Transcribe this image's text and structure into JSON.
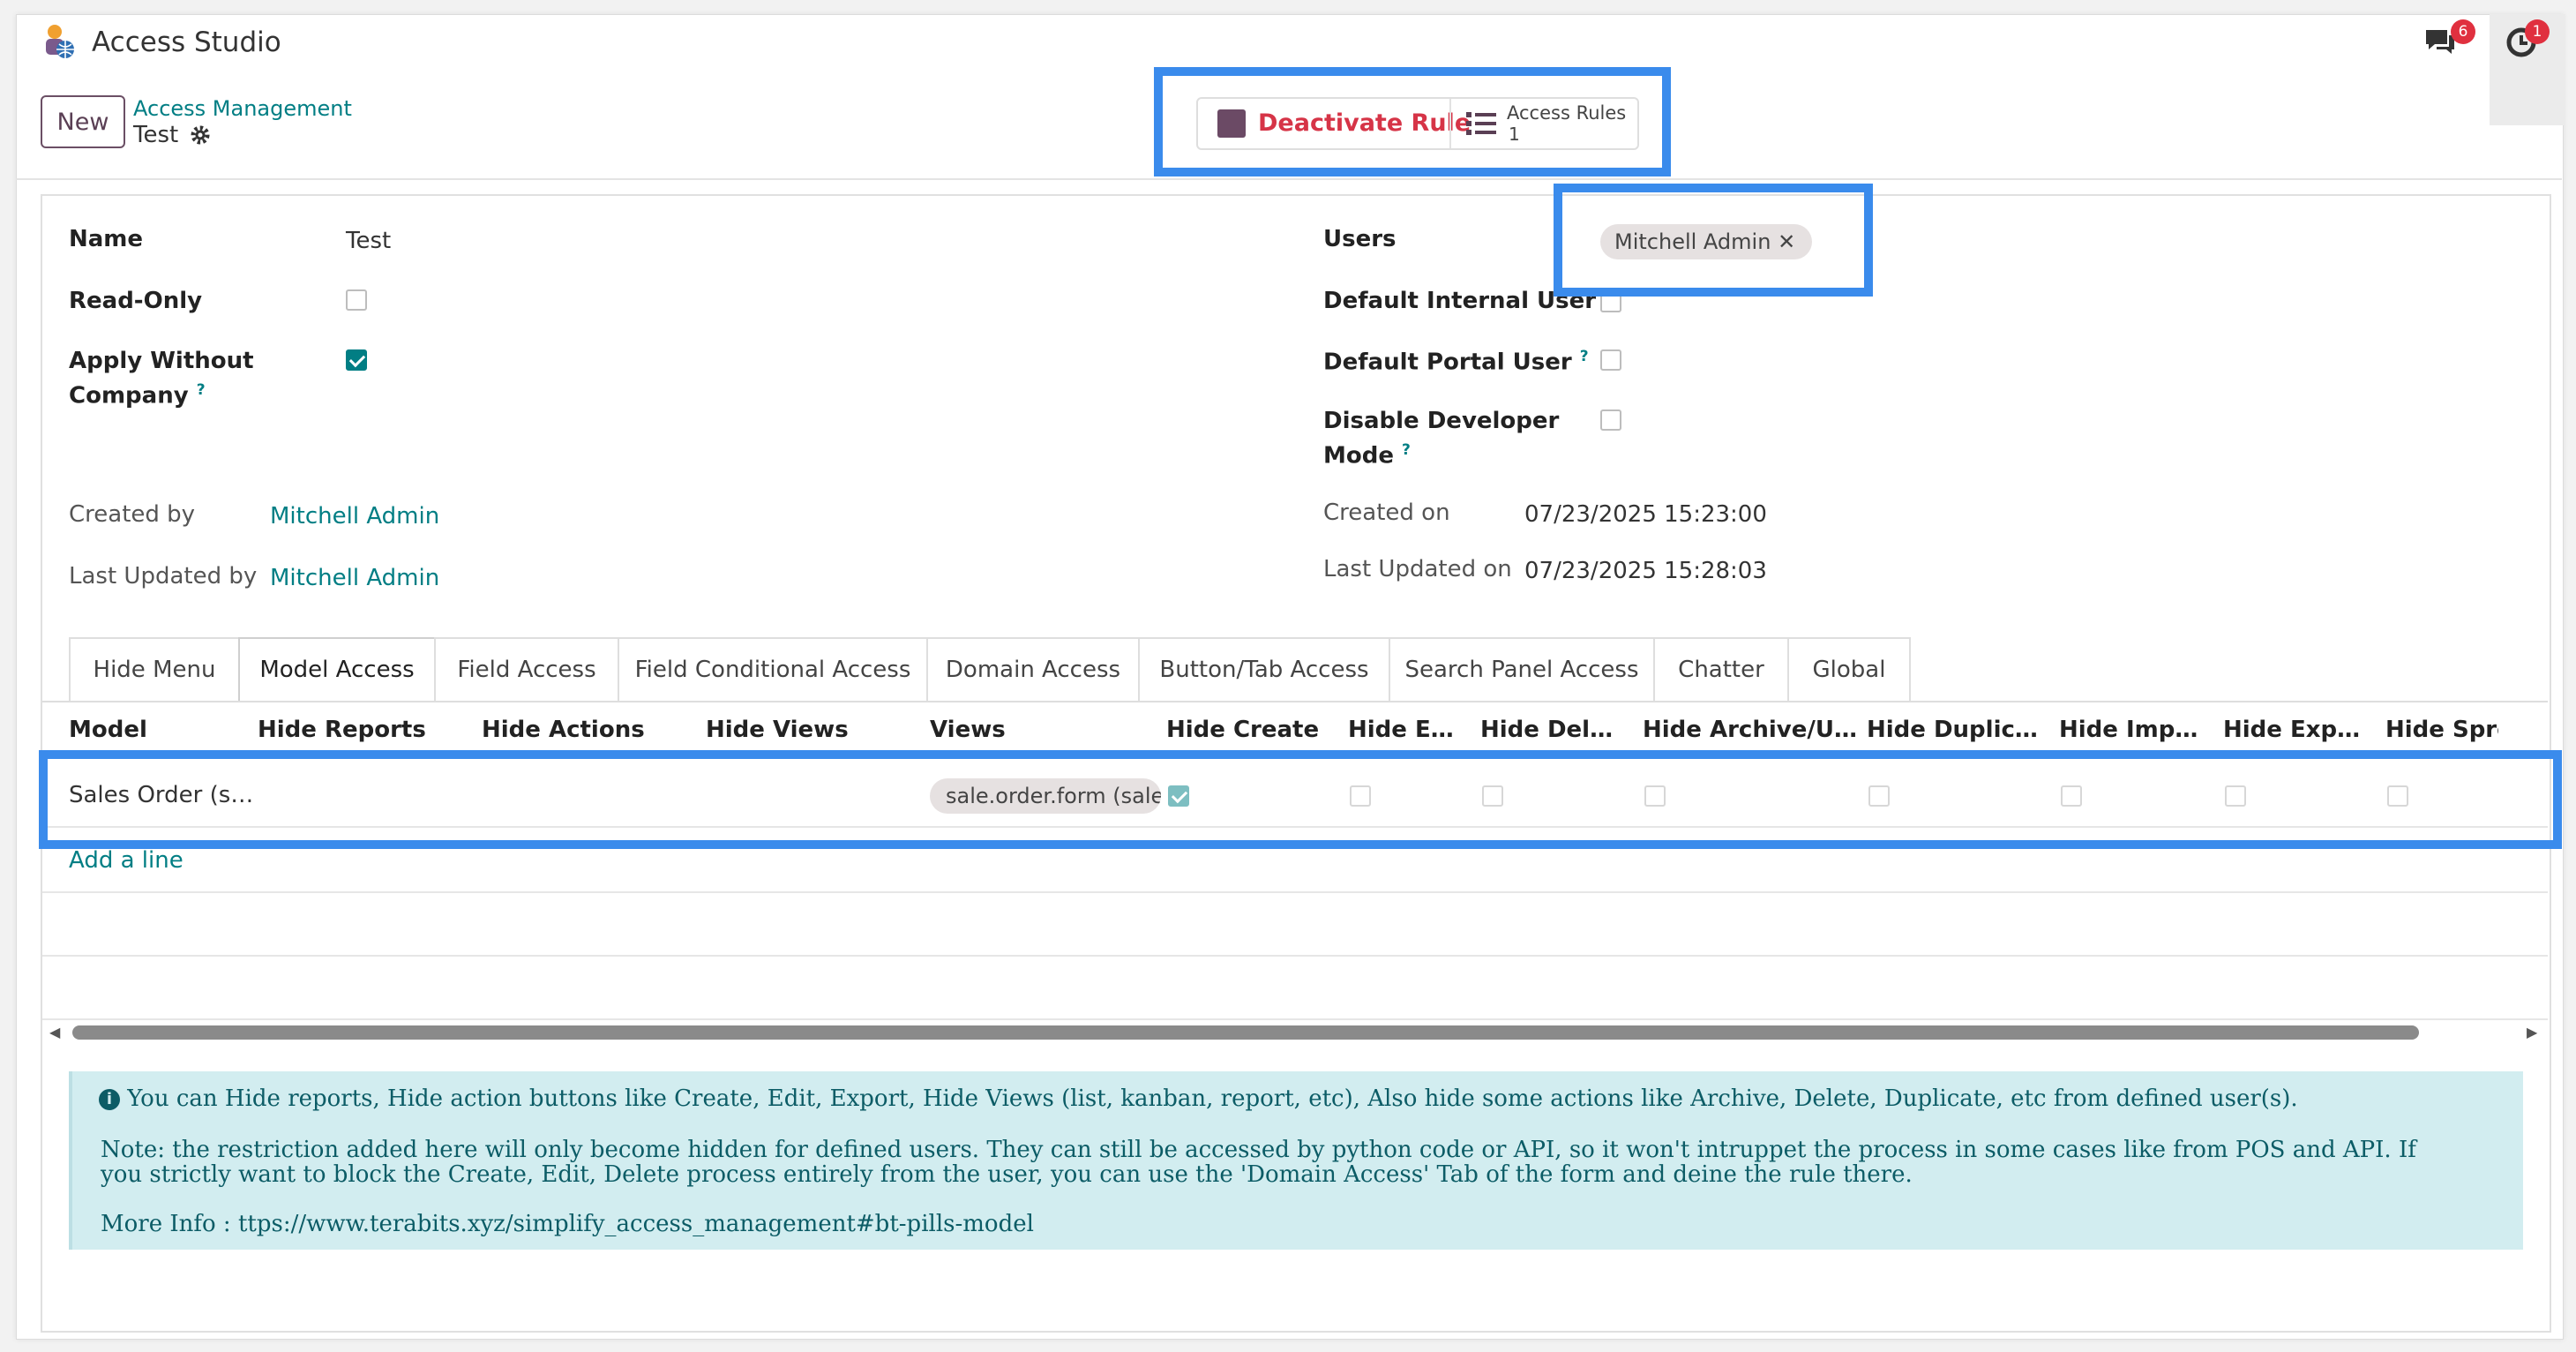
{
  "app": {
    "title": "Access Studio"
  },
  "systray": {
    "chat_badge": "6",
    "activity_badge": "1"
  },
  "control_panel": {
    "new_label": "New",
    "breadcrumb": "Access Management",
    "record_name": "Test"
  },
  "actions": {
    "deactivate_label": "Deactivate Rule",
    "access_rules_label": "Access Rules",
    "access_rules_count": "1"
  },
  "form": {
    "name_label": "Name",
    "name_value": "Test",
    "readonly_label": "Read-Only",
    "readonly_checked": false,
    "apply_label_1": "Apply Without",
    "apply_label_2": "Company",
    "apply_checked": true,
    "users_label": "Users",
    "users_tag": "Mitchell Admin",
    "default_internal_label": "Default Internal User",
    "default_portal_label": "Default Portal User",
    "disable_dev_label_1": "Disable Developer",
    "disable_dev_label_2": "Mode",
    "help_mark": "?",
    "created_by_label": "Created by",
    "created_by_value": "Mitchell Admin",
    "last_updated_by_label": "Last Updated by",
    "last_updated_by_value": "Mitchell Admin",
    "created_on_label": "Created on",
    "created_on_value": "07/23/2025 15:23:00",
    "last_updated_on_label": "Last Updated on",
    "last_updated_on_value": "07/23/2025 15:28:03"
  },
  "tabs": [
    "Hide Menu",
    "Model Access",
    "Field Access",
    "Field Conditional Access",
    "Domain Access",
    "Button/Tab Access",
    "Search Panel Access",
    "Chatter",
    "Global"
  ],
  "active_tab": "Model Access",
  "table": {
    "columns": [
      "Model",
      "Hide Reports",
      "Hide Actions",
      "Hide Views",
      "Views",
      "Hide Create",
      "Hide E…",
      "Hide Del…",
      "Hide Archive/U…",
      "Hide Duplic…",
      "Hide Imp…",
      "Hide Exp…",
      "Hide Sprea"
    ],
    "row": {
      "model": "Sales Order (s…",
      "views_tag": "sale.order.form (sale.o",
      "hide_create": true
    },
    "add_line": "Add a line"
  },
  "info": {
    "line1": "You can Hide reports, Hide action buttons like Create, Edit, Export, Hide Views (list, kanban, report, etc), Also hide some actions like Archive, Delete, Duplicate, etc from defined user(s).",
    "note1": "Note: the restriction added here will only become hidden for defined users. They can still be accessed by python code or API, so it won't intruppet the process in some cases like from POS and API. If",
    "note2": "you strictly want to block the Create, Edit, Delete process entirely from the user, you can use the 'Domain Access' Tab of the form and deine the rule there.",
    "more_label": "More Info : ",
    "more_link": "ttps://www.terabits.xyz/simplify_access_management#bt-pills-model"
  },
  "colors": {
    "accent": "#017e84",
    "brand": "#6b4a65",
    "danger": "#d63447",
    "highlight": "#3a8bec"
  }
}
